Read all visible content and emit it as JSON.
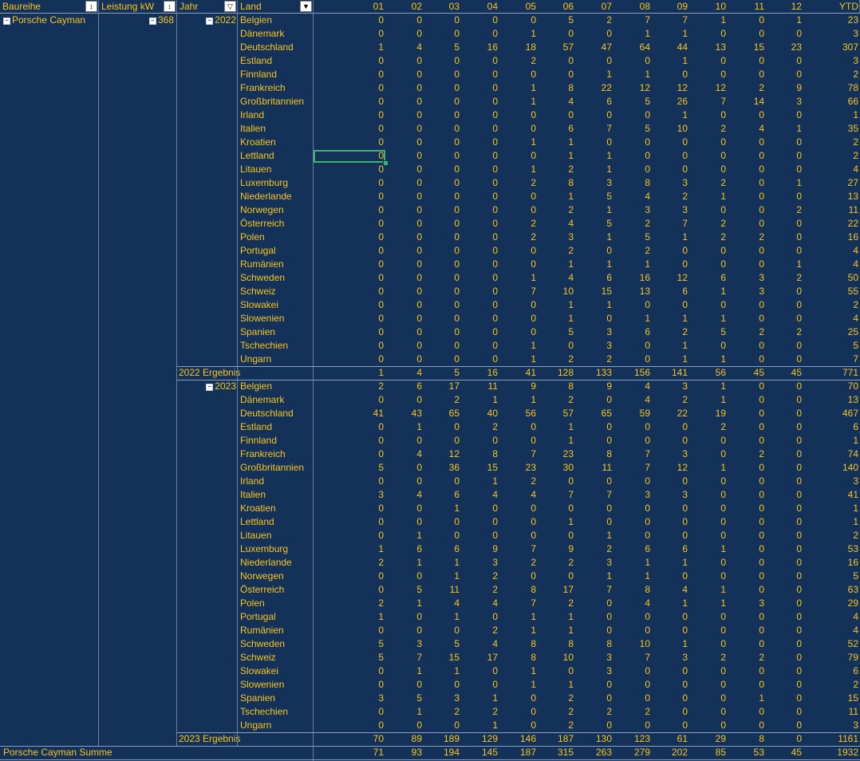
{
  "headers": {
    "baureihe": "Baureihe",
    "leistung": "Leistung kW",
    "jahr": "Jahr",
    "land": "Land",
    "months": [
      "01",
      "02",
      "03",
      "04",
      "05",
      "06",
      "07",
      "08",
      "09",
      "10",
      "11",
      "12"
    ],
    "ytd": "YTD"
  },
  "filter_icons": {
    "sort_filter": "sort-filter-icon",
    "filter": "filter-icon",
    "dropdown": "dropdown-icon"
  },
  "model": "Porsche Cayman",
  "power": "368",
  "years": [
    {
      "year": "2022",
      "rows": [
        {
          "country": "Belgien",
          "values": [
            "0",
            "0",
            "0",
            "0",
            "0",
            "5",
            "2",
            "7",
            "7",
            "1",
            "0",
            "1"
          ],
          "ytd": "23"
        },
        {
          "country": "Dänemark",
          "values": [
            "0",
            "0",
            "0",
            "0",
            "1",
            "0",
            "0",
            "1",
            "1",
            "0",
            "0",
            "0"
          ],
          "ytd": "3"
        },
        {
          "country": "Deutschland",
          "values": [
            "1",
            "4",
            "5",
            "16",
            "18",
            "57",
            "47",
            "64",
            "44",
            "13",
            "15",
            "23"
          ],
          "ytd": "307"
        },
        {
          "country": "Estland",
          "values": [
            "0",
            "0",
            "0",
            "0",
            "2",
            "0",
            "0",
            "0",
            "1",
            "0",
            "0",
            "0"
          ],
          "ytd": "3"
        },
        {
          "country": "Finnland",
          "values": [
            "0",
            "0",
            "0",
            "0",
            "0",
            "0",
            "1",
            "1",
            "0",
            "0",
            "0",
            "0"
          ],
          "ytd": "2"
        },
        {
          "country": "Frankreich",
          "values": [
            "0",
            "0",
            "0",
            "0",
            "1",
            "8",
            "22",
            "12",
            "12",
            "12",
            "2",
            "9"
          ],
          "ytd": "78"
        },
        {
          "country": "Großbritannien",
          "values": [
            "0",
            "0",
            "0",
            "0",
            "1",
            "4",
            "6",
            "5",
            "26",
            "7",
            "14",
            "3"
          ],
          "ytd": "66"
        },
        {
          "country": "Irland",
          "values": [
            "0",
            "0",
            "0",
            "0",
            "0",
            "0",
            "0",
            "0",
            "1",
            "0",
            "0",
            "0"
          ],
          "ytd": "1"
        },
        {
          "country": "Italien",
          "values": [
            "0",
            "0",
            "0",
            "0",
            "0",
            "6",
            "7",
            "5",
            "10",
            "2",
            "4",
            "1"
          ],
          "ytd": "35"
        },
        {
          "country": "Kroatien",
          "values": [
            "0",
            "0",
            "0",
            "0",
            "1",
            "1",
            "0",
            "0",
            "0",
            "0",
            "0",
            "0"
          ],
          "ytd": "2"
        },
        {
          "country": "Lettland",
          "values": [
            "0",
            "0",
            "0",
            "0",
            "0",
            "1",
            "1",
            "0",
            "0",
            "0",
            "0",
            "0"
          ],
          "ytd": "2"
        },
        {
          "country": "Litauen",
          "values": [
            "0",
            "0",
            "0",
            "0",
            "1",
            "2",
            "1",
            "0",
            "0",
            "0",
            "0",
            "0"
          ],
          "ytd": "4"
        },
        {
          "country": "Luxemburg",
          "values": [
            "0",
            "0",
            "0",
            "0",
            "2",
            "8",
            "3",
            "8",
            "3",
            "2",
            "0",
            "1"
          ],
          "ytd": "27"
        },
        {
          "country": "Niederlande",
          "values": [
            "0",
            "0",
            "0",
            "0",
            "0",
            "1",
            "5",
            "4",
            "2",
            "1",
            "0",
            "0"
          ],
          "ytd": "13"
        },
        {
          "country": "Norwegen",
          "values": [
            "0",
            "0",
            "0",
            "0",
            "0",
            "2",
            "1",
            "3",
            "3",
            "0",
            "0",
            "2"
          ],
          "ytd": "11"
        },
        {
          "country": "Österreich",
          "values": [
            "0",
            "0",
            "0",
            "0",
            "2",
            "4",
            "5",
            "2",
            "7",
            "2",
            "0",
            "0"
          ],
          "ytd": "22"
        },
        {
          "country": "Polen",
          "values": [
            "0",
            "0",
            "0",
            "0",
            "2",
            "3",
            "1",
            "5",
            "1",
            "2",
            "2",
            "0"
          ],
          "ytd": "16"
        },
        {
          "country": "Portugal",
          "values": [
            "0",
            "0",
            "0",
            "0",
            "0",
            "2",
            "0",
            "2",
            "0",
            "0",
            "0",
            "0"
          ],
          "ytd": "4"
        },
        {
          "country": "Rumänien",
          "values": [
            "0",
            "0",
            "0",
            "0",
            "0",
            "1",
            "1",
            "1",
            "0",
            "0",
            "0",
            "1"
          ],
          "ytd": "4"
        },
        {
          "country": "Schweden",
          "values": [
            "0",
            "0",
            "0",
            "0",
            "1",
            "4",
            "6",
            "16",
            "12",
            "6",
            "3",
            "2"
          ],
          "ytd": "50"
        },
        {
          "country": "Schweiz",
          "values": [
            "0",
            "0",
            "0",
            "0",
            "7",
            "10",
            "15",
            "13",
            "6",
            "1",
            "3",
            "0"
          ],
          "ytd": "55"
        },
        {
          "country": "Slowakei",
          "values": [
            "0",
            "0",
            "0",
            "0",
            "0",
            "1",
            "1",
            "0",
            "0",
            "0",
            "0",
            "0"
          ],
          "ytd": "2"
        },
        {
          "country": "Slowenien",
          "values": [
            "0",
            "0",
            "0",
            "0",
            "0",
            "1",
            "0",
            "1",
            "1",
            "1",
            "0",
            "0"
          ],
          "ytd": "4"
        },
        {
          "country": "Spanien",
          "values": [
            "0",
            "0",
            "0",
            "0",
            "0",
            "5",
            "3",
            "6",
            "2",
            "5",
            "2",
            "2"
          ],
          "ytd": "25"
        },
        {
          "country": "Tschechien",
          "values": [
            "0",
            "0",
            "0",
            "0",
            "1",
            "0",
            "3",
            "0",
            "1",
            "0",
            "0",
            "0"
          ],
          "ytd": "5"
        },
        {
          "country": "Ungarn",
          "values": [
            "0",
            "0",
            "0",
            "0",
            "1",
            "2",
            "2",
            "0",
            "1",
            "1",
            "0",
            "0"
          ],
          "ytd": "7"
        }
      ],
      "total_label": "2022 Ergebnis",
      "total_values": [
        "1",
        "4",
        "5",
        "16",
        "41",
        "128",
        "133",
        "156",
        "141",
        "56",
        "45",
        "45"
      ],
      "total_ytd": "771"
    },
    {
      "year": "2023",
      "rows": [
        {
          "country": "Belgien",
          "values": [
            "2",
            "6",
            "17",
            "11",
            "9",
            "8",
            "9",
            "4",
            "3",
            "1",
            "0",
            "0"
          ],
          "ytd": "70"
        },
        {
          "country": "Dänemark",
          "values": [
            "0",
            "0",
            "2",
            "1",
            "1",
            "2",
            "0",
            "4",
            "2",
            "1",
            "0",
            "0"
          ],
          "ytd": "13"
        },
        {
          "country": "Deutschland",
          "values": [
            "41",
            "43",
            "65",
            "40",
            "56",
            "57",
            "65",
            "59",
            "22",
            "19",
            "0",
            "0"
          ],
          "ytd": "467"
        },
        {
          "country": "Estland",
          "values": [
            "0",
            "1",
            "0",
            "2",
            "0",
            "1",
            "0",
            "0",
            "0",
            "2",
            "0",
            "0"
          ],
          "ytd": "6"
        },
        {
          "country": "Finnland",
          "values": [
            "0",
            "0",
            "0",
            "0",
            "0",
            "1",
            "0",
            "0",
            "0",
            "0",
            "0",
            "0"
          ],
          "ytd": "1"
        },
        {
          "country": "Frankreich",
          "values": [
            "0",
            "4",
            "12",
            "8",
            "7",
            "23",
            "8",
            "7",
            "3",
            "0",
            "2",
            "0"
          ],
          "ytd": "74"
        },
        {
          "country": "Großbritannien",
          "values": [
            "5",
            "0",
            "36",
            "15",
            "23",
            "30",
            "11",
            "7",
            "12",
            "1",
            "0",
            "0"
          ],
          "ytd": "140"
        },
        {
          "country": "Irland",
          "values": [
            "0",
            "0",
            "0",
            "1",
            "2",
            "0",
            "0",
            "0",
            "0",
            "0",
            "0",
            "0"
          ],
          "ytd": "3"
        },
        {
          "country": "Italien",
          "values": [
            "3",
            "4",
            "6",
            "4",
            "4",
            "7",
            "7",
            "3",
            "3",
            "0",
            "0",
            "0"
          ],
          "ytd": "41"
        },
        {
          "country": "Kroatien",
          "values": [
            "0",
            "0",
            "1",
            "0",
            "0",
            "0",
            "0",
            "0",
            "0",
            "0",
            "0",
            "0"
          ],
          "ytd": "1"
        },
        {
          "country": "Lettland",
          "values": [
            "0",
            "0",
            "0",
            "0",
            "0",
            "1",
            "0",
            "0",
            "0",
            "0",
            "0",
            "0"
          ],
          "ytd": "1"
        },
        {
          "country": "Litauen",
          "values": [
            "0",
            "1",
            "0",
            "0",
            "0",
            "0",
            "1",
            "0",
            "0",
            "0",
            "0",
            "0"
          ],
          "ytd": "2"
        },
        {
          "country": "Luxemburg",
          "values": [
            "1",
            "6",
            "6",
            "9",
            "7",
            "9",
            "2",
            "6",
            "6",
            "1",
            "0",
            "0"
          ],
          "ytd": "53"
        },
        {
          "country": "Niederlande",
          "values": [
            "2",
            "1",
            "1",
            "3",
            "2",
            "2",
            "3",
            "1",
            "1",
            "0",
            "0",
            "0"
          ],
          "ytd": "16"
        },
        {
          "country": "Norwegen",
          "values": [
            "0",
            "0",
            "1",
            "2",
            "0",
            "0",
            "1",
            "1",
            "0",
            "0",
            "0",
            "0"
          ],
          "ytd": "5"
        },
        {
          "country": "Österreich",
          "values": [
            "0",
            "5",
            "11",
            "2",
            "8",
            "17",
            "7",
            "8",
            "4",
            "1",
            "0",
            "0"
          ],
          "ytd": "63"
        },
        {
          "country": "Polen",
          "values": [
            "2",
            "1",
            "4",
            "4",
            "7",
            "2",
            "0",
            "4",
            "1",
            "1",
            "3",
            "0"
          ],
          "ytd": "29"
        },
        {
          "country": "Portugal",
          "values": [
            "1",
            "0",
            "1",
            "0",
            "1",
            "1",
            "0",
            "0",
            "0",
            "0",
            "0",
            "0"
          ],
          "ytd": "4"
        },
        {
          "country": "Rumänien",
          "values": [
            "0",
            "0",
            "0",
            "2",
            "1",
            "1",
            "0",
            "0",
            "0",
            "0",
            "0",
            "0"
          ],
          "ytd": "4"
        },
        {
          "country": "Schweden",
          "values": [
            "5",
            "3",
            "5",
            "4",
            "8",
            "8",
            "8",
            "10",
            "1",
            "0",
            "0",
            "0"
          ],
          "ytd": "52"
        },
        {
          "country": "Schweiz",
          "values": [
            "5",
            "7",
            "15",
            "17",
            "8",
            "10",
            "3",
            "7",
            "3",
            "2",
            "2",
            "0"
          ],
          "ytd": "79"
        },
        {
          "country": "Slowakei",
          "values": [
            "0",
            "1",
            "1",
            "0",
            "1",
            "0",
            "3",
            "0",
            "0",
            "0",
            "0",
            "0"
          ],
          "ytd": "6"
        },
        {
          "country": "Slowenien",
          "values": [
            "0",
            "0",
            "0",
            "0",
            "1",
            "1",
            "0",
            "0",
            "0",
            "0",
            "0",
            "0"
          ],
          "ytd": "2"
        },
        {
          "country": "Spanien",
          "values": [
            "3",
            "5",
            "3",
            "1",
            "0",
            "2",
            "0",
            "0",
            "0",
            "0",
            "1",
            "0"
          ],
          "ytd": "15"
        },
        {
          "country": "Tschechien",
          "values": [
            "0",
            "1",
            "2",
            "2",
            "0",
            "2",
            "2",
            "2",
            "0",
            "0",
            "0",
            "0"
          ],
          "ytd": "11"
        },
        {
          "country": "Ungarn",
          "values": [
            "0",
            "0",
            "0",
            "1",
            "0",
            "2",
            "0",
            "0",
            "0",
            "0",
            "0",
            "0"
          ],
          "ytd": "3"
        }
      ],
      "total_label": "2023 Ergebnis",
      "total_values": [
        "70",
        "89",
        "189",
        "129",
        "146",
        "187",
        "130",
        "123",
        "61",
        "29",
        "8",
        "0"
      ],
      "total_ytd": "1161"
    }
  ],
  "grand_total_label": "Porsche Cayman Summe",
  "grand_total_values": [
    "71",
    "93",
    "194",
    "145",
    "187",
    "315",
    "263",
    "279",
    "202",
    "85",
    "53",
    "45"
  ],
  "grand_total_ytd": "1932",
  "selected_cell": {
    "year_index": 0,
    "row_index": 10
  },
  "colors": {
    "background": "#14315a",
    "text": "#f6c51e",
    "selection": "#3cb371"
  }
}
